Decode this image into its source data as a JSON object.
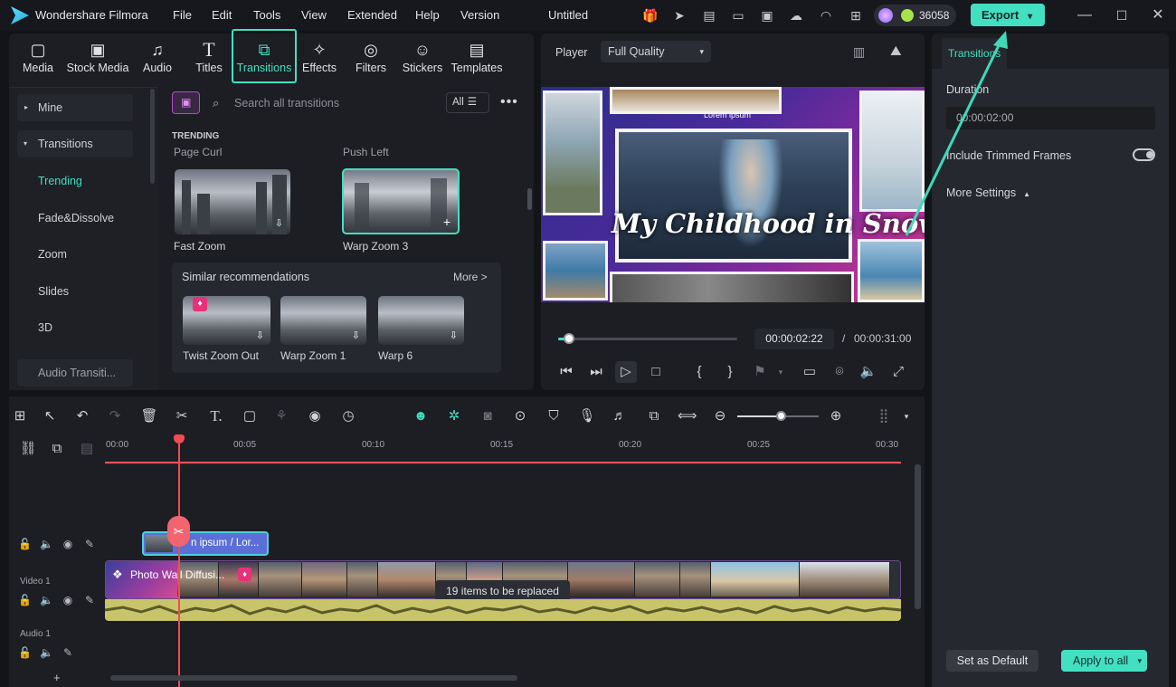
{
  "app": {
    "title": "Wondershare Filmora",
    "project": "Untitled",
    "credits": "36058",
    "export_label": "Export"
  },
  "menu": [
    "File",
    "Edit",
    "Tools",
    "View",
    "Extended",
    "Help",
    "Version"
  ],
  "library_tabs": [
    "Media",
    "Stock Media",
    "Audio",
    "Titles",
    "Transitions",
    "Effects",
    "Filters",
    "Stickers",
    "Templates"
  ],
  "sidebar": {
    "items": [
      "Mine",
      "Transitions",
      "Trending",
      "Fade&Dissolve",
      "Zoom",
      "Slides",
      "3D",
      "Audio Transiti..."
    ]
  },
  "browser": {
    "search_placeholder": "Search all transitions",
    "filter_label": "All",
    "section": "TRENDING",
    "top_labels": [
      "Page Curl",
      "Push Left"
    ],
    "items": [
      "Fast Zoom",
      "Warp Zoom 3"
    ],
    "similar": {
      "title": "Similar recommendations",
      "more": "More >",
      "items": [
        "Twist Zoom Out",
        "Warp Zoom 1",
        "Warp 6"
      ]
    }
  },
  "player": {
    "label": "Player",
    "quality": "Full Quality",
    "overlay_title": "My Childhood in Snow",
    "lorem": "Lorem ipsum",
    "current_time": "00:00:02:22",
    "separator": "/",
    "total_time": "00:00:31:00",
    "progress": 0.06
  },
  "properties": {
    "tab": "Transitions",
    "duration_label": "Duration",
    "duration_value": "00:00:02:00",
    "trimmed_label": "Include Trimmed Frames",
    "more_settings": "More Settings",
    "set_default": "Set as Default",
    "apply_all": "Apply to all"
  },
  "timeline": {
    "ruler": [
      "00:00",
      "00:05",
      "00:10",
      "00:15",
      "00:20",
      "00:25",
      "00:30"
    ],
    "title_clip": "n ipsum / Lor...",
    "video_track": "Video 1",
    "audio_track": "Audio 1",
    "video_clip": "Photo Wall Diffusi...",
    "replace_note": "19 items to be replaced",
    "track_add": "+"
  },
  "colors": {
    "accent": "#43dfc2",
    "playhead": "#f04b55",
    "audio_wave": "#c8c46a",
    "title_clip": "#5b6fd6"
  }
}
